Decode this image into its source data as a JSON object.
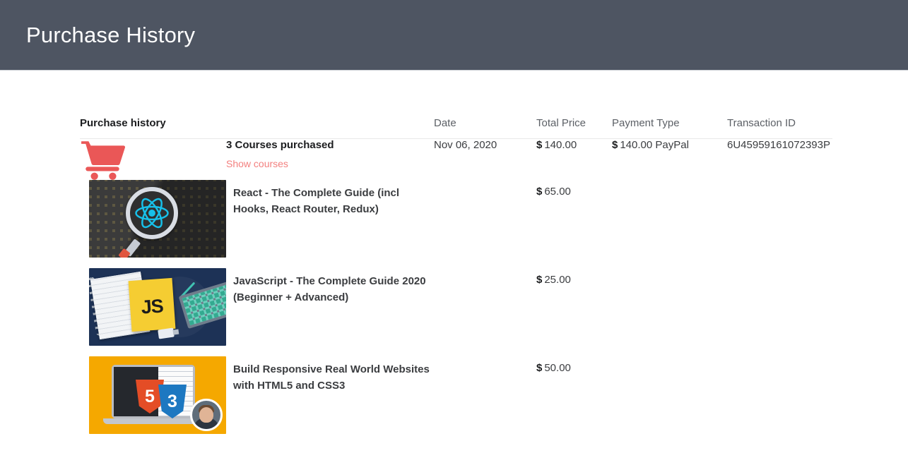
{
  "header": {
    "title": "Purchase History",
    "background": "#4e5562",
    "text_color": "#ffffff"
  },
  "table": {
    "columns": [
      {
        "key": "main",
        "label": "Purchase history"
      },
      {
        "key": "date",
        "label": "Date"
      },
      {
        "key": "price",
        "label": "Total Price"
      },
      {
        "key": "ptype",
        "label": "Payment Type"
      },
      {
        "key": "txn",
        "label": "Transaction ID"
      }
    ],
    "order": {
      "icon": "shopping-cart-icon",
      "summary": "3 Courses purchased",
      "toggle_label": "Show courses",
      "toggle_color": "#f3807f",
      "date": "Nov 06, 2020",
      "total_price": {
        "symbol": "$",
        "amount": "140.00"
      },
      "payment": {
        "symbol": "$",
        "amount": "140.00",
        "method": "PayPal"
      },
      "transaction_id": "6U45959161072393P"
    },
    "courses": [
      {
        "thumb": "react-course-thumbnail",
        "title": "React - The Complete Guide (incl Hooks, React Router, Redux)",
        "price": {
          "symbol": "$",
          "amount": "65.00"
        }
      },
      {
        "thumb": "javascript-course-thumbnail",
        "title": "JavaScript - The Complete Guide 2020 (Beginner + Advanced)",
        "price": {
          "symbol": "$",
          "amount": "25.00"
        }
      },
      {
        "thumb": "html-css-course-thumbnail",
        "title": "Build Responsive Real World Websites with HTML5 and CSS3",
        "price": {
          "symbol": "$",
          "amount": "50.00"
        }
      }
    ]
  },
  "thumbnails": {
    "react": {
      "js_label": "",
      "background": "#3b3b3b",
      "logo_color": "#17c0e9"
    },
    "javascript": {
      "js_label": "JS",
      "background": "#1d3256",
      "sticky_color": "#f5cd32"
    },
    "html_css": {
      "html_label": "5",
      "css_label": "3",
      "background": "#f5a800"
    }
  }
}
